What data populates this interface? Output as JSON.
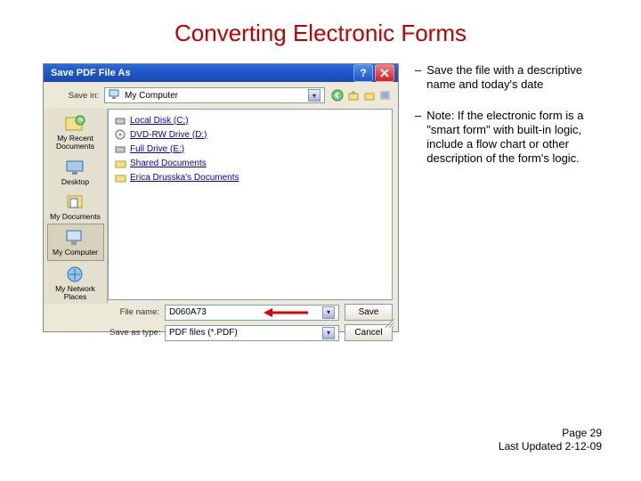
{
  "slide": {
    "title": "Converting Electronic Forms",
    "notes": [
      "Save the file with a descriptive name and today's date",
      "Note:  If the electronic form is a \"smart form\" with built-in logic, include a flow chart or other description of the form's logic."
    ],
    "footer_page": "Page 29",
    "footer_updated": "Last Updated 2-12-09"
  },
  "dialog": {
    "title": "Save PDF File As",
    "savein_label": "Save in:",
    "savein_value": "My Computer",
    "nav_icons": [
      "back-icon",
      "up-icon",
      "new-folder-icon",
      "views-icon"
    ],
    "places": [
      {
        "label": "My Recent Documents",
        "icon": "recent"
      },
      {
        "label": "Desktop",
        "icon": "desktop"
      },
      {
        "label": "My Documents",
        "icon": "docs"
      },
      {
        "label": "My Computer",
        "icon": "computer"
      },
      {
        "label": "My Network Places",
        "icon": "network"
      }
    ],
    "files": [
      {
        "label": "Local Disk (C:)",
        "icon": "disk"
      },
      {
        "label": "DVD-RW Drive (D:)",
        "icon": "dvd"
      },
      {
        "label": "Full Drive (E:)",
        "icon": "disk"
      },
      {
        "label": "Shared Documents",
        "icon": "folder"
      },
      {
        "label": "Erica Drusska's Documents",
        "icon": "folder"
      }
    ],
    "filename_label": "File name:",
    "filename_value": "D060A73",
    "savetype_label": "Save as type:",
    "savetype_value": "PDF files (*.PDF)",
    "save_btn": "Save",
    "cancel_btn": "Cancel"
  }
}
